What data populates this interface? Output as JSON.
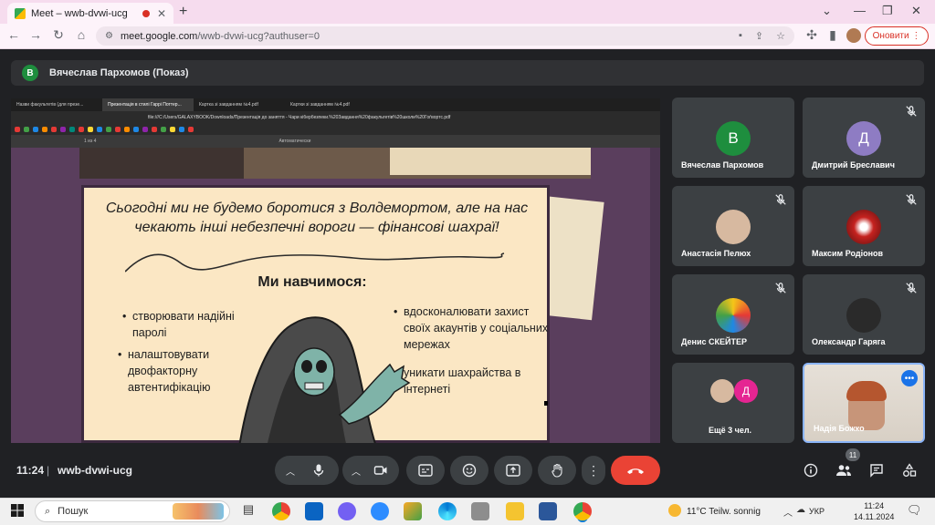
{
  "browser": {
    "tab_title": "Meet – wwb-dvwi-ucg",
    "new_tab_glyph": "+",
    "url_host": "meet.google.com",
    "url_path": "/wwb-dvwi-ucg?authuser=0",
    "update_label": "Оновити"
  },
  "meet": {
    "presenter_initial": "В",
    "presenter_label": "Вячеслав Пархомов (Показ)",
    "time": "11:24",
    "separator": "|",
    "meeting_code": "wwb-dvwi-ucg",
    "participant_count": "11",
    "tiles": [
      {
        "name": "Вячеслав Пархомов",
        "initial": "В",
        "color": "#1e8e3e",
        "muted": false
      },
      {
        "name": "Дмитрий Бреславич",
        "initial": "Д",
        "color": "#8e7cc3",
        "muted": true
      },
      {
        "name": "Анастасія Пелюх",
        "initial": "",
        "color": "#d7b9a0",
        "muted": true
      },
      {
        "name": "Максим Родіонов",
        "initial": "",
        "color": "#c5221f",
        "muted": true
      },
      {
        "name": "Денис СКЕЙТЕР",
        "initial": "",
        "color": "#f5c518",
        "muted": true
      },
      {
        "name": "Олександр Гаряга",
        "initial": "",
        "color": "#2a2a2a",
        "muted": true
      },
      {
        "name": "Ещё 3 чел.",
        "initial": "Д",
        "color": "#e52592",
        "muted": false
      },
      {
        "name": "Надія Божко",
        "initial": "",
        "color": "#cfc8c2",
        "muted": false
      }
    ]
  },
  "shared_screen": {
    "inner_tabs": [
      "Назви факультетів (для презе...",
      "Презентація в стилі Гаррі Поттер...",
      "Картка зі завданням №4.pdf",
      "Картки зі завданням №4.pdf"
    ],
    "inner_url": "file:///C:/Users/GALAXYBOOK/Downloads/Презентація до заняття - Чари кібербезпеки.%20Завдання%20факультетів%20школи%20Гоґвортс.pdf",
    "pdf_page": "1 из 4",
    "pdf_zoom": "Автоматически",
    "slide": {
      "headline": "Сьогодні ми не будемо боротися з Волдемортом, але на нас чекають інші небезпечні вороги — фінансові шахраї!",
      "subtitle": "Ми навчимося:",
      "left_bullets": [
        "створювати надійні паролі",
        "налаштовувати двофакторну автентифікацію"
      ],
      "right_bullets": [
        "вдосконалювати захист своїх акаунтів у соціальних мережах",
        "уникати шахрайства в інтернеті"
      ]
    }
  },
  "taskbar": {
    "search_placeholder": "Пошук",
    "weather": "11°C  Teilw. sonnig",
    "lang": "УКР",
    "clock_time": "11:24",
    "clock_date": "14.11.2024"
  }
}
